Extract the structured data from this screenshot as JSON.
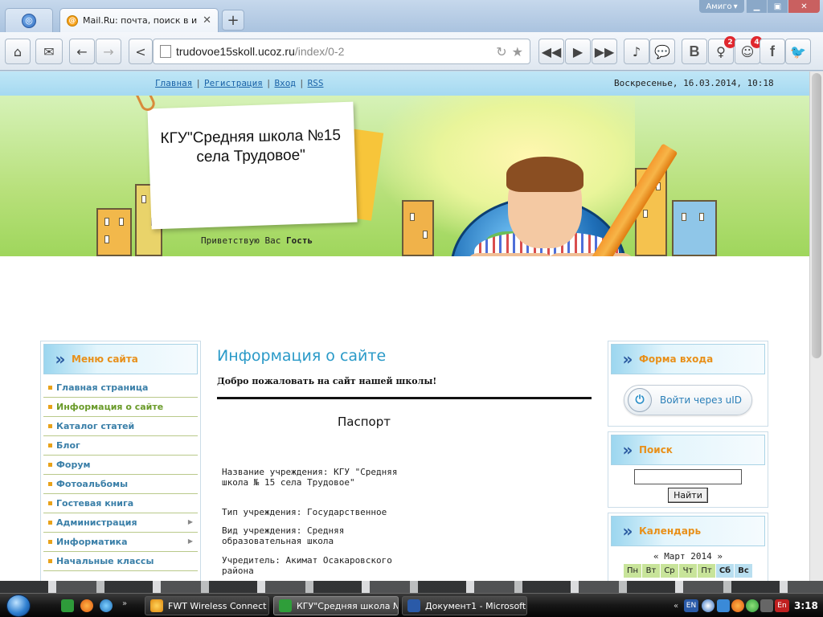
{
  "browser": {
    "user_label": "Амиго",
    "tab_title": "Mail.Ru: почта, поиск в интер",
    "address_host": "trudovoe15skoll.ucoz.ru",
    "address_path": "/index/0-2",
    "badges": {
      "ok": "2",
      "smile": "4"
    },
    "social": {
      "vk": "В",
      "fb": "f"
    }
  },
  "site": {
    "top_links": [
      "Главная",
      "Регистрация",
      "Вход",
      "RSS"
    ],
    "datetime": "Воскресенье, 16.03.2014, 10:18",
    "title": "КГУ\"Средняя школа №15 села Трудовое\"",
    "greeting_prefix": "Приветствую Вас",
    "greeting_user": "Гость"
  },
  "menu": {
    "title": "Меню сайта",
    "items": [
      "Главная страница",
      "Информация о сайте",
      "Каталог статей",
      "Блог",
      "Форум",
      "Фотоальбомы",
      "Гостевая книга",
      "Администрация",
      "Информатика",
      "Начальные классы"
    ]
  },
  "content": {
    "title": "Информация о сайте",
    "welcome": "Добро пожаловать на сайт нашей школы!",
    "heading": "Паспорт",
    "paragraphs": [
      "Название учреждения: КГУ \"Средняя школа № 15 села Трудовое\"",
      "Тип учреждения: Государственное",
      "Вид учреждения: Средняя образовательная школа",
      "Учредитель: Акимат Осакаровского района"
    ]
  },
  "login": {
    "title": "Форма входа",
    "uid_button": "Войти через uID"
  },
  "search": {
    "title": "Поиск",
    "button": "Найти"
  },
  "calendar": {
    "title": "Календарь",
    "prev": "«",
    "month": "Март 2014",
    "next": "»",
    "days": [
      "Пн",
      "Вт",
      "Ср",
      "Чт",
      "Пт",
      "Сб",
      "Вс"
    ]
  },
  "taskbar": {
    "tasks": [
      "FWT Wireless Connect",
      "КГУ\"Средняя школа №...",
      "Документ1 - Microsoft ..."
    ],
    "lang": "EN",
    "lang2": "En",
    "time": "3:18"
  }
}
